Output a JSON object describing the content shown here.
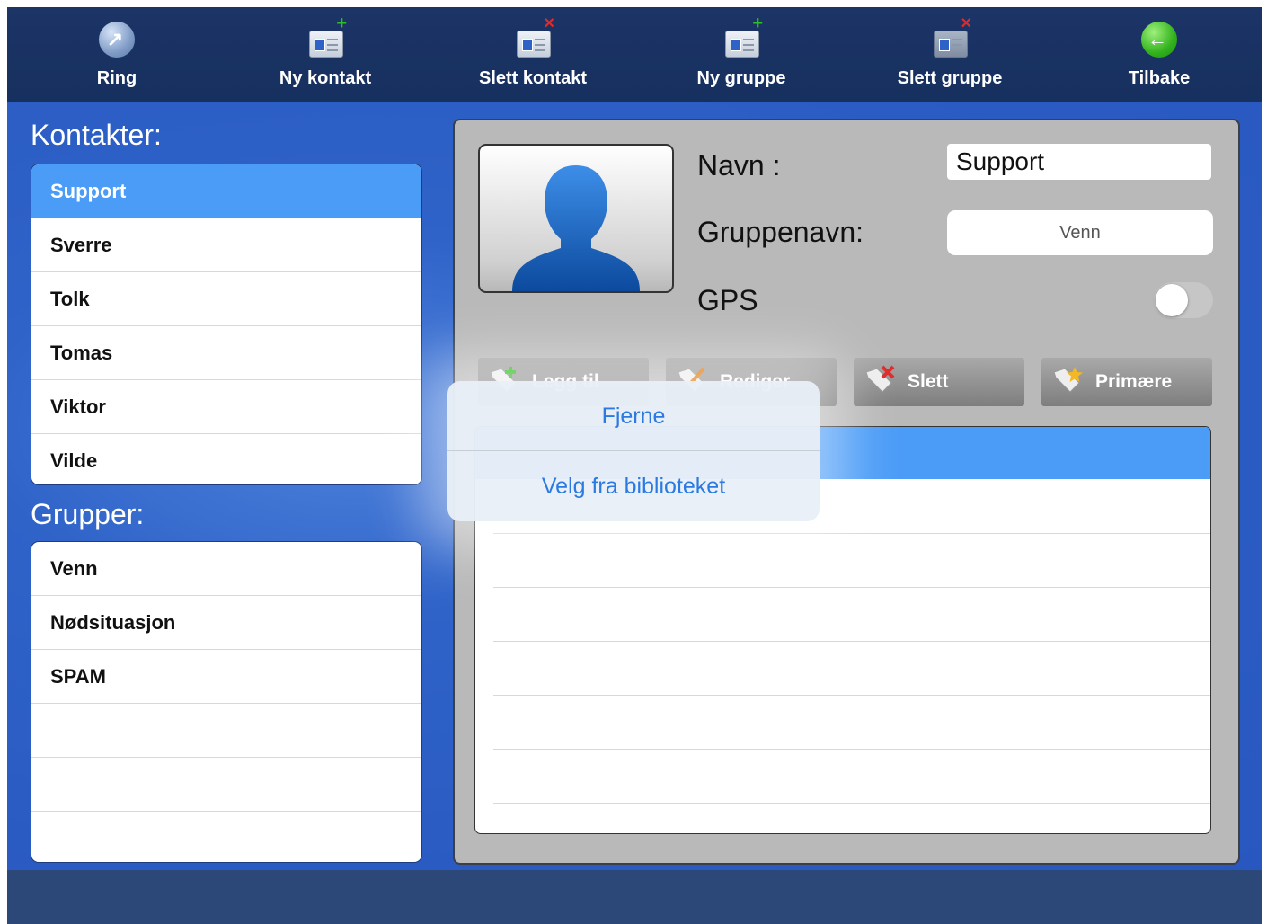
{
  "toolbar": {
    "ring": "Ring",
    "new_contact": "Ny kontakt",
    "delete_contact": "Slett kontakt",
    "new_group": "Ny gruppe",
    "delete_group": "Slett gruppe",
    "back": "Tilbake"
  },
  "contacts": {
    "title": "Kontakter:",
    "items": [
      "Support",
      "Sverre",
      "Tolk",
      "Tomas",
      "Viktor",
      "Vilde"
    ],
    "selected": "Support"
  },
  "groups": {
    "title": "Grupper:",
    "items": [
      "Venn",
      "Nødsituasjon",
      "SPAM"
    ]
  },
  "details": {
    "name_label": "Navn :",
    "name_value": "Support",
    "group_label": "Gruppenavn:",
    "group_value": "Venn",
    "gps_label": "GPS",
    "gps_enabled": false
  },
  "actions": {
    "add": "Legg til",
    "edit": "Rediger",
    "delete": "Slett",
    "primary": "Primære"
  },
  "popover": {
    "remove": "Fjerne",
    "choose_library": "Velg fra biblioteket"
  },
  "colors": {
    "toolbar_bg": "#1c3466",
    "main_bg": "#2f63c8",
    "selection": "#4b9cf7",
    "popover_text": "#2a7ae2"
  }
}
